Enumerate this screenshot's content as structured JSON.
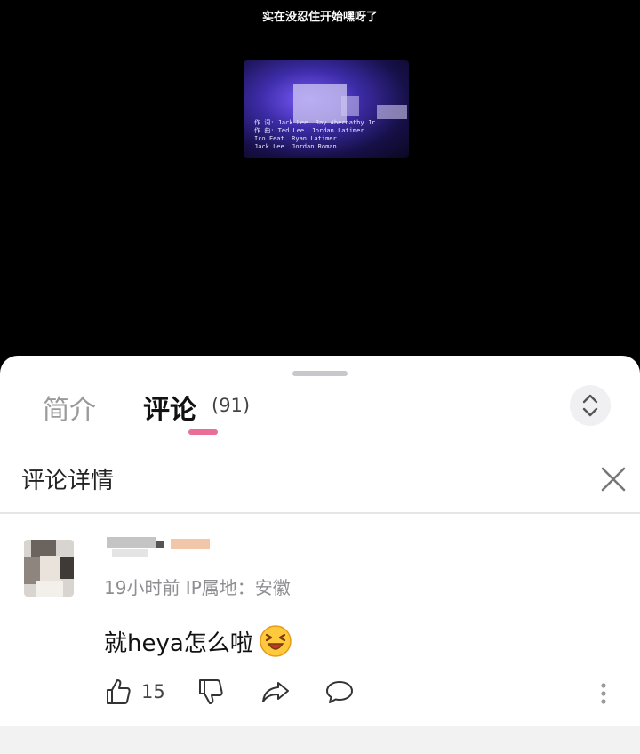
{
  "video": {
    "subtitle": "实在没忍住开始嘿呀了",
    "credits": "作 词: Jack Lee  Ray Abernathy Jr.\n作 曲: Ted Lee  Jordan Latimer\nIco Feat. Ryan Latimer\nJack Lee  Jordan Roman"
  },
  "sheet": {
    "tabs": [
      {
        "label": "简介"
      },
      {
        "label": "评论",
        "count": "(91)"
      }
    ],
    "detail_title": "评论详情",
    "icons": {
      "expand": "expand-collapse-icon",
      "close": "close-icon"
    }
  },
  "comment": {
    "meta": "19小时前 IP属地：安徽",
    "text": "就heya怎么啦",
    "emoji": "laughing-face-emoji",
    "likes": "15",
    "icons": [
      "thumbs-up-icon",
      "thumbs-down-icon",
      "share-icon",
      "reply-icon",
      "more-icon"
    ]
  },
  "colors": {
    "accent": "#ea6f97",
    "meta_text": "#8e8e93"
  }
}
